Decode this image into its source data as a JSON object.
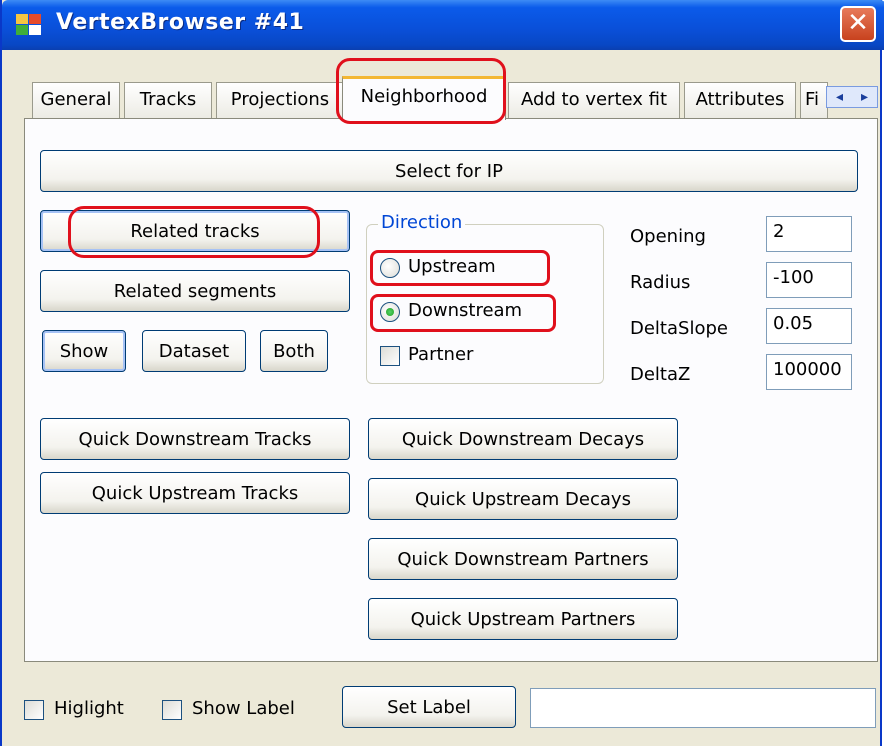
{
  "window": {
    "title": "VertexBrowser #41",
    "close_glyph": "✕"
  },
  "tabs": [
    {
      "label": "General"
    },
    {
      "label": "Tracks"
    },
    {
      "label": "Projections"
    },
    {
      "label": "Neighborhood"
    },
    {
      "label": "Add to vertex fit"
    },
    {
      "label": "Attributes"
    },
    {
      "label": "Fi"
    }
  ],
  "active_tab": "Neighborhood",
  "tab_scroll": {
    "left": "◂",
    "right": "▸"
  },
  "neighborhood": {
    "select_for_ip": "Select for IP",
    "related_tracks": "Related tracks",
    "related_segments": "Related segments",
    "show": "Show",
    "dataset": "Dataset",
    "both": "Both",
    "direction": {
      "legend": "Direction",
      "upstream": "Upstream",
      "downstream": "Downstream",
      "partner": "Partner",
      "selected": "Downstream",
      "partner_checked": false
    },
    "params": [
      {
        "label": "Opening",
        "value": "2"
      },
      {
        "label": "Radius",
        "value": "-100"
      },
      {
        "label": "DeltaSlope",
        "value": "0.05"
      },
      {
        "label": "DeltaZ",
        "value": "100000"
      }
    ],
    "quick_downstream_tracks": "Quick Downstream Tracks",
    "quick_upstream_tracks": "Quick Upstream Tracks",
    "quick_downstream_decays": "Quick Downstream Decays",
    "quick_upstream_decays": "Quick Upstream Decays",
    "quick_downstream_partners": "Quick Downstream Partners",
    "quick_upstream_partners": "Quick Upstream Partners"
  },
  "footer": {
    "highlight": "Higlight",
    "show_label": "Show Label",
    "set_label": "Set Label",
    "label_value": ""
  },
  "colors": {
    "title_bar": "#0a4fd8",
    "annotation": "#e0101c",
    "active_tab_accent": "#f3b733",
    "group_legend": "#0046d5"
  }
}
